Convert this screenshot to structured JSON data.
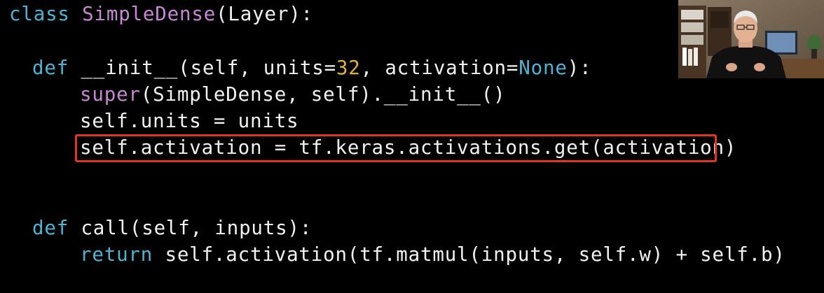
{
  "code": {
    "line1": {
      "keyword": "class ",
      "class_name": "SimpleDense",
      "rest": "(Layer):"
    },
    "line2": {
      "keyword": "def ",
      "name": "__init__(self, units=",
      "number": "32",
      "sep": ", activation=",
      "none_kw": "None",
      "end": "):"
    },
    "line3": {
      "builtin": "super",
      "rest": "(SimpleDense, self).__init__()"
    },
    "line4": {
      "text": "self.units = units"
    },
    "line5": {
      "text": "self.activation = tf.keras.activations.get(activation)"
    },
    "line6": {
      "keyword": "def ",
      "rest": "call(self, inputs):"
    },
    "line7": {
      "keyword": "return ",
      "rest": "self.activation(tf.matmul(inputs, self.w) + self.b)"
    }
  },
  "colors": {
    "background": "#000000",
    "keyword": "#4fb3d4",
    "class_name": "#c987d6",
    "number": "#e6b13a",
    "text": "#f2f2f2",
    "highlight_border": "#e3342a"
  },
  "presenter": {
    "icon": "presenter-webcam-video"
  }
}
